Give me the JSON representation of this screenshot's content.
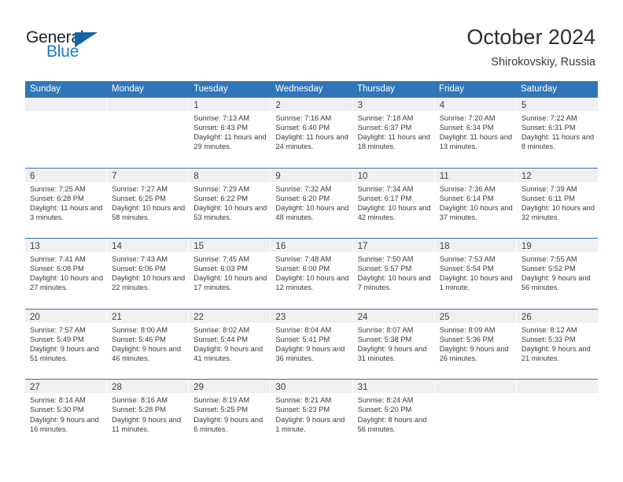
{
  "brand": {
    "name_primary": "General",
    "name_secondary": "Blue",
    "accent_color": "#1464a5",
    "logo_text_color": "#231f20"
  },
  "header": {
    "title": "October 2024",
    "subtitle": "Shirokovskiy, Russia"
  },
  "theme": {
    "header_row_color": "#3077b9",
    "week_separator_color": "#2f72b2",
    "daynum_band_color": "#f0f0f0",
    "text_color": "#3b3b3b"
  },
  "weekdays": [
    "Sunday",
    "Monday",
    "Tuesday",
    "Wednesday",
    "Thursday",
    "Friday",
    "Saturday"
  ],
  "weeks": [
    [
      {
        "day": "",
        "sunrise": "",
        "sunset": "",
        "daylight": "",
        "empty": true
      },
      {
        "day": "",
        "sunrise": "",
        "sunset": "",
        "daylight": "",
        "empty": true
      },
      {
        "day": "1",
        "sunrise": "Sunrise: 7:13 AM",
        "sunset": "Sunset: 6:43 PM",
        "daylight": "Daylight: 11 hours and 29 minutes."
      },
      {
        "day": "2",
        "sunrise": "Sunrise: 7:16 AM",
        "sunset": "Sunset: 6:40 PM",
        "daylight": "Daylight: 11 hours and 24 minutes."
      },
      {
        "day": "3",
        "sunrise": "Sunrise: 7:18 AM",
        "sunset": "Sunset: 6:37 PM",
        "daylight": "Daylight: 11 hours and 18 minutes."
      },
      {
        "day": "4",
        "sunrise": "Sunrise: 7:20 AM",
        "sunset": "Sunset: 6:34 PM",
        "daylight": "Daylight: 11 hours and 13 minutes."
      },
      {
        "day": "5",
        "sunrise": "Sunrise: 7:22 AM",
        "sunset": "Sunset: 6:31 PM",
        "daylight": "Daylight: 11 hours and 8 minutes."
      }
    ],
    [
      {
        "day": "6",
        "sunrise": "Sunrise: 7:25 AM",
        "sunset": "Sunset: 6:28 PM",
        "daylight": "Daylight: 11 hours and 3 minutes."
      },
      {
        "day": "7",
        "sunrise": "Sunrise: 7:27 AM",
        "sunset": "Sunset: 6:25 PM",
        "daylight": "Daylight: 10 hours and 58 minutes."
      },
      {
        "day": "8",
        "sunrise": "Sunrise: 7:29 AM",
        "sunset": "Sunset: 6:22 PM",
        "daylight": "Daylight: 10 hours and 53 minutes."
      },
      {
        "day": "9",
        "sunrise": "Sunrise: 7:32 AM",
        "sunset": "Sunset: 6:20 PM",
        "daylight": "Daylight: 10 hours and 48 minutes."
      },
      {
        "day": "10",
        "sunrise": "Sunrise: 7:34 AM",
        "sunset": "Sunset: 6:17 PM",
        "daylight": "Daylight: 10 hours and 42 minutes."
      },
      {
        "day": "11",
        "sunrise": "Sunrise: 7:36 AM",
        "sunset": "Sunset: 6:14 PM",
        "daylight": "Daylight: 10 hours and 37 minutes."
      },
      {
        "day": "12",
        "sunrise": "Sunrise: 7:39 AM",
        "sunset": "Sunset: 6:11 PM",
        "daylight": "Daylight: 10 hours and 32 minutes."
      }
    ],
    [
      {
        "day": "13",
        "sunrise": "Sunrise: 7:41 AM",
        "sunset": "Sunset: 6:08 PM",
        "daylight": "Daylight: 10 hours and 27 minutes."
      },
      {
        "day": "14",
        "sunrise": "Sunrise: 7:43 AM",
        "sunset": "Sunset: 6:06 PM",
        "daylight": "Daylight: 10 hours and 22 minutes."
      },
      {
        "day": "15",
        "sunrise": "Sunrise: 7:45 AM",
        "sunset": "Sunset: 6:03 PM",
        "daylight": "Daylight: 10 hours and 17 minutes."
      },
      {
        "day": "16",
        "sunrise": "Sunrise: 7:48 AM",
        "sunset": "Sunset: 6:00 PM",
        "daylight": "Daylight: 10 hours and 12 minutes."
      },
      {
        "day": "17",
        "sunrise": "Sunrise: 7:50 AM",
        "sunset": "Sunset: 5:57 PM",
        "daylight": "Daylight: 10 hours and 7 minutes."
      },
      {
        "day": "18",
        "sunrise": "Sunrise: 7:53 AM",
        "sunset": "Sunset: 5:54 PM",
        "daylight": "Daylight: 10 hours and 1 minute."
      },
      {
        "day": "19",
        "sunrise": "Sunrise: 7:55 AM",
        "sunset": "Sunset: 5:52 PM",
        "daylight": "Daylight: 9 hours and 56 minutes."
      }
    ],
    [
      {
        "day": "20",
        "sunrise": "Sunrise: 7:57 AM",
        "sunset": "Sunset: 5:49 PM",
        "daylight": "Daylight: 9 hours and 51 minutes."
      },
      {
        "day": "21",
        "sunrise": "Sunrise: 8:00 AM",
        "sunset": "Sunset: 5:46 PM",
        "daylight": "Daylight: 9 hours and 46 minutes."
      },
      {
        "day": "22",
        "sunrise": "Sunrise: 8:02 AM",
        "sunset": "Sunset: 5:44 PM",
        "daylight": "Daylight: 9 hours and 41 minutes."
      },
      {
        "day": "23",
        "sunrise": "Sunrise: 8:04 AM",
        "sunset": "Sunset: 5:41 PM",
        "daylight": "Daylight: 9 hours and 36 minutes."
      },
      {
        "day": "24",
        "sunrise": "Sunrise: 8:07 AM",
        "sunset": "Sunset: 5:38 PM",
        "daylight": "Daylight: 9 hours and 31 minutes."
      },
      {
        "day": "25",
        "sunrise": "Sunrise: 8:09 AM",
        "sunset": "Sunset: 5:36 PM",
        "daylight": "Daylight: 9 hours and 26 minutes."
      },
      {
        "day": "26",
        "sunrise": "Sunrise: 8:12 AM",
        "sunset": "Sunset: 5:33 PM",
        "daylight": "Daylight: 9 hours and 21 minutes."
      }
    ],
    [
      {
        "day": "27",
        "sunrise": "Sunrise: 8:14 AM",
        "sunset": "Sunset: 5:30 PM",
        "daylight": "Daylight: 9 hours and 16 minutes."
      },
      {
        "day": "28",
        "sunrise": "Sunrise: 8:16 AM",
        "sunset": "Sunset: 5:28 PM",
        "daylight": "Daylight: 9 hours and 11 minutes."
      },
      {
        "day": "29",
        "sunrise": "Sunrise: 8:19 AM",
        "sunset": "Sunset: 5:25 PM",
        "daylight": "Daylight: 9 hours and 6 minutes."
      },
      {
        "day": "30",
        "sunrise": "Sunrise: 8:21 AM",
        "sunset": "Sunset: 5:23 PM",
        "daylight": "Daylight: 9 hours and 1 minute."
      },
      {
        "day": "31",
        "sunrise": "Sunrise: 8:24 AM",
        "sunset": "Sunset: 5:20 PM",
        "daylight": "Daylight: 8 hours and 56 minutes."
      },
      {
        "day": "",
        "sunrise": "",
        "sunset": "",
        "daylight": "",
        "empty": true
      },
      {
        "day": "",
        "sunrise": "",
        "sunset": "",
        "daylight": "",
        "empty": true
      }
    ]
  ]
}
